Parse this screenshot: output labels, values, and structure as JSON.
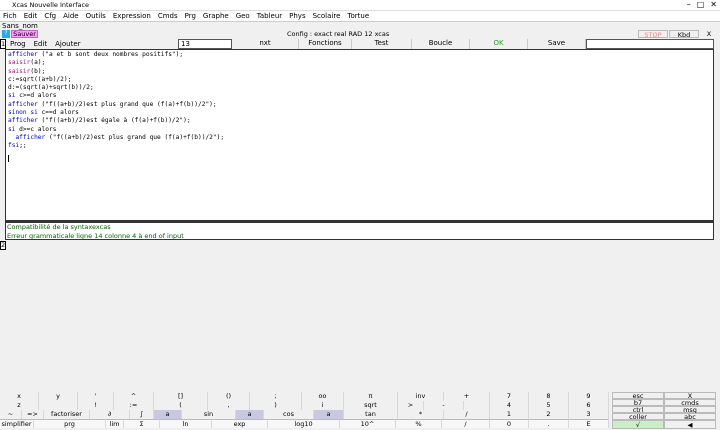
{
  "window": {
    "title": "Xcas Nouvelle Interface"
  },
  "menubar": [
    "Fich",
    "Edit",
    "Cfg",
    "Aide",
    "Outils",
    "Expression",
    "Cmds",
    "Prg",
    "Graphe",
    "Geo",
    "Tableur",
    "Phys",
    "Scolaire",
    "Tortue"
  ],
  "session": {
    "name": "Sans_nom",
    "help_label": "?",
    "save_label": "Sauver",
    "config": "Config : exact real RAD 12 xcas",
    "stop_label": "STOP",
    "kbd_label": "Kbd",
    "close_label": "X"
  },
  "level1": {
    "number": "1"
  },
  "prog_menu": [
    "Prog",
    "Edit",
    "Ajouter"
  ],
  "prog_input": {
    "value": "13"
  },
  "prog_buttons": [
    "nxt",
    "Fonctions",
    "Test",
    "Boucle",
    "OK",
    "Save"
  ],
  "code_lines": [
    {
      "kw": "afficher",
      "rest": " (\"a et b sont deux nombres positifs\");"
    },
    {
      "kw": "saisir",
      "rest": "(a);"
    },
    {
      "kw": "saisir",
      "rest": "(b);"
    },
    {
      "kw": "",
      "rest": "c:=sqrt((a+b)/2);"
    },
    {
      "kw": "",
      "rest": "d:=(sqrt(a)+sqrt(b))/2;"
    },
    {
      "kw": "si",
      "rest": " c>=d alors"
    },
    {
      "kw": "afficher",
      "rest": " (\"f((a+b)/2)est plus grand que (f(a)+f(b))/2\");"
    },
    {
      "kw": "sinon si",
      "rest": " c==d alors"
    },
    {
      "kw": "afficher",
      "rest": " (\"f((a+b)/2)est égale à (f(a)+f(b))/2\");"
    },
    {
      "kw": "si",
      "rest": " d>=c alors"
    },
    {
      "kw": "  afficher",
      "rest": " (\"f((a+b)/2)est plus grand que (f(a)+f(b))/2\");"
    },
    {
      "kw": "fsi",
      "rest": ";;"
    }
  ],
  "messages": [
    "Compatibilité de la syntaxexcas",
    "Erreur grammaticale ligne 14 colonne 4 à end of input"
  ],
  "level2": {
    "number": "2"
  },
  "keyboard": {
    "row1": [
      "x",
      "y",
      "'",
      "^",
      "[]",
      "()",
      ";",
      "oo",
      "π",
      "inv",
      "+",
      "7",
      "8",
      "9"
    ],
    "row2": [
      "z",
      "",
      "!",
      ":=",
      "(",
      ",",
      ")",
      "i",
      "sqrt",
      ">",
      "-",
      "4",
      "5",
      "6"
    ],
    "row3": [
      "~",
      "=>",
      "factoriser",
      "∂",
      "∫",
      "a",
      "sin",
      "a",
      "cos",
      "a",
      "tan",
      "*",
      "/",
      "1",
      "2",
      "3"
    ],
    "row4": [
      "simplifier",
      "prg",
      "lim",
      "Σ",
      "ln",
      "exp",
      "log10",
      "10^",
      "%",
      "/",
      "0",
      ".",
      "E"
    ],
    "side": [
      "esc",
      "X",
      "b7",
      "cmds",
      "ctrl",
      "msg",
      "coller",
      "abc",
      "√",
      "◀"
    ]
  }
}
